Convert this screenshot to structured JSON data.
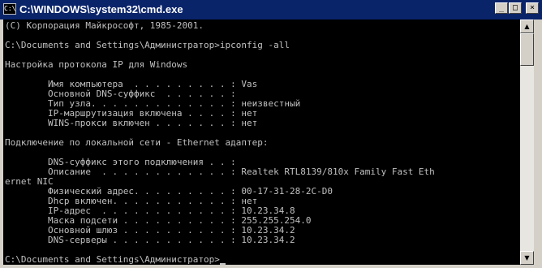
{
  "window": {
    "title": "C:\\WINDOWS\\system32\\cmd.exe",
    "icon_label": "C:\\",
    "controls": {
      "minimize": "_",
      "maximize": "□",
      "close": "×"
    }
  },
  "console": {
    "lines": [
      "(C) Корпорация Майкрософт, 1985-2001.",
      "",
      "C:\\Documents and Settings\\Администратор>ipconfig -all",
      "",
      "Настройка протокола IP для Windows",
      "",
      "        Имя компьютера  . . . . . . . . . : Vas",
      "        Основной DNS-суффикс  . . . . . . :",
      "        Тип узла. . . . . . . . . . . . . : неизвестный",
      "        IP-маршрутизация включена . . . . : нет",
      "        WINS-прокси включен . . . . . . . : нет",
      "",
      "Подключение по локальной сети - Ethernet адаптер:",
      "",
      "        DNS-суффикс этого подключения . . :",
      "        Описание  . . . . . . . . . . . . : Realtek RTL8139/810x Family Fast Eth",
      "ernet NIC",
      "        Физический адрес. . . . . . . . . : 00-17-31-28-2C-D0",
      "        Dhcp включен. . . . . . . . . . . : нет",
      "        IP-адрес  . . . . . . . . . . . . : 10.23.34.8",
      "        Маска подсети . . . . . . . . . . : 255.255.254.0",
      "        Основной шлюз . . . . . . . . . . : 10.23.34.2",
      "        DNS-серверы . . . . . . . . . . . : 10.23.34.2",
      "",
      "C:\\Documents and Settings\\Администратор>"
    ]
  },
  "colors": {
    "title_bar": "#0a246a",
    "console_bg": "#000000",
    "console_fg": "#c0c0c0",
    "chrome": "#d4d0c8"
  },
  "icons": {
    "window_icon": "cmd-prompt-icon",
    "scroll_up": "arrow-up-icon",
    "scroll_down": "arrow-down-icon"
  }
}
